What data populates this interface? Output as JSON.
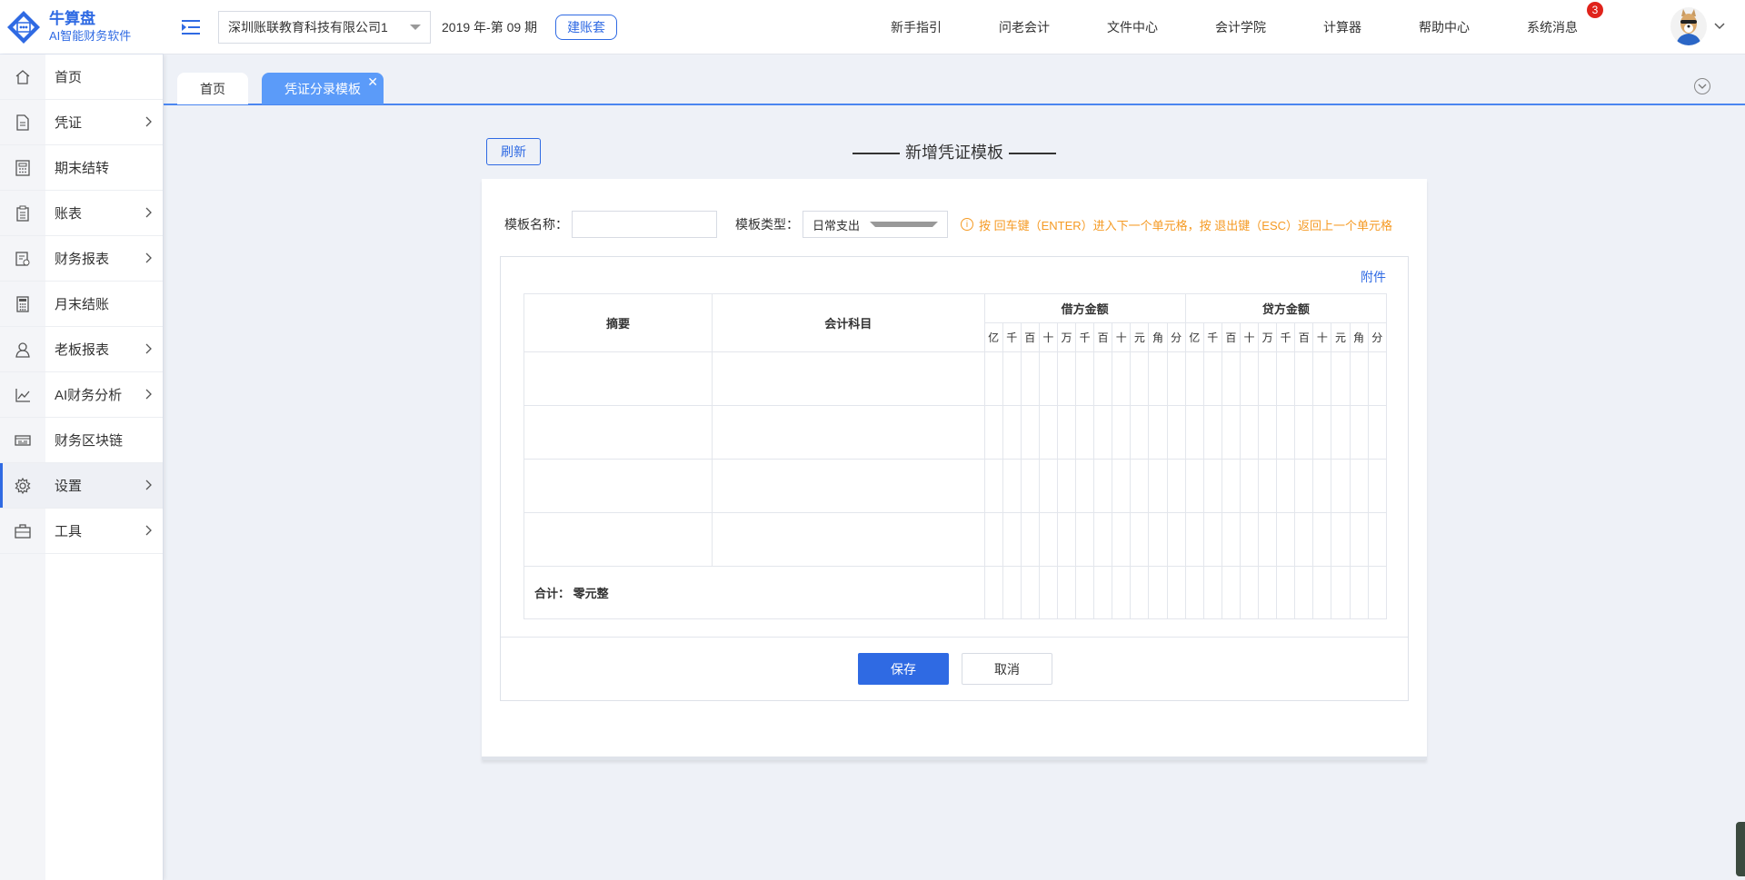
{
  "logo": {
    "name": "牛算盘",
    "tagline": "AI智能财务软件"
  },
  "sidebar": {
    "items": [
      {
        "label": "首页",
        "icon": "home-icon",
        "chevron": false,
        "active": false
      },
      {
        "label": "凭证",
        "icon": "document-icon",
        "chevron": true,
        "active": false
      },
      {
        "label": "期末结转",
        "icon": "calculator-grid-icon",
        "chevron": false,
        "active": false
      },
      {
        "label": "账表",
        "icon": "clipboard-icon",
        "chevron": true,
        "active": false
      },
      {
        "label": "财务报表",
        "icon": "report-icon",
        "chevron": true,
        "active": false
      },
      {
        "label": "月末结账",
        "icon": "calculator-icon",
        "chevron": false,
        "active": false
      },
      {
        "label": "老板报表",
        "icon": "user-icon",
        "chevron": true,
        "active": false
      },
      {
        "label": "AI财务分析",
        "icon": "line-chart-icon",
        "chevron": true,
        "active": false
      },
      {
        "label": "财务区块链",
        "icon": "blockchain-icon",
        "chevron": false,
        "active": false
      },
      {
        "label": "设置",
        "icon": "gear-icon",
        "chevron": true,
        "active": true
      },
      {
        "label": "工具",
        "icon": "toolbox-icon",
        "chevron": true,
        "active": false
      }
    ]
  },
  "header": {
    "company": "深圳账联教育科技有限公司1",
    "period": "2019 年-第 09 期",
    "new_book": "建账套",
    "nav": [
      "新手指引",
      "问老会计",
      "文件中心",
      "会计学院",
      "计算器",
      "帮助中心",
      "系统消息"
    ],
    "message_badge": "3"
  },
  "tabs": [
    {
      "label": "首页",
      "active": false
    },
    {
      "label": "凭证分录模板",
      "active": true
    }
  ],
  "page": {
    "refresh": "刷新",
    "title": "新增凭证模板"
  },
  "form": {
    "name_label": "模板名称：",
    "name_value": "",
    "type_label": "模板类型：",
    "type_value": "日常支出",
    "hint_icon": "i",
    "hint": "按 回车键（ENTER）进入下一个单元格，按 退出键（ESC）返回上一个单元格",
    "attach": "附件"
  },
  "table": {
    "col_summary": "摘要",
    "col_subject": "会计科目",
    "col_debit": "借方金额",
    "col_credit": "贷方金额",
    "digits": [
      "亿",
      "千",
      "百",
      "十",
      "万",
      "千",
      "百",
      "十",
      "元",
      "角",
      "分"
    ],
    "total_label": "合计：",
    "total_value": "零元整"
  },
  "actions": {
    "save": "保存",
    "cancel": "取消"
  },
  "colors": {
    "accent": "#2f6ae3",
    "tab_active": "#5b9bf9",
    "hint": "#f59a23",
    "badge": "#e0231b"
  }
}
